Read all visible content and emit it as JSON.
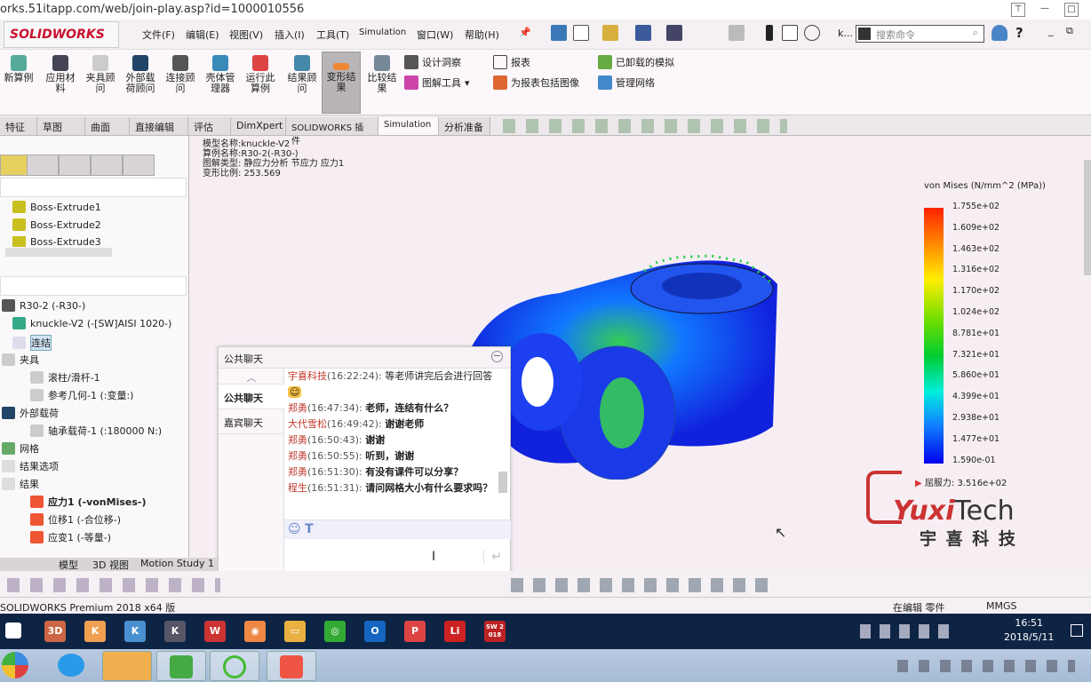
{
  "browser": {
    "url": "orks.51itapp.com/web/join-play.asp?id=1000010556"
  },
  "app": {
    "logo": "SOLIDWORKS",
    "menus": [
      "文件(F)",
      "编辑(E)",
      "视图(V)",
      "插入(I)",
      "工具(T)",
      "Simulation",
      "窗口(W)",
      "帮助(H)"
    ],
    "search_placeholder": "搜索命令",
    "k_label": "k..."
  },
  "ribbon": {
    "buttons": [
      "新算例",
      "应用材料",
      "夹具顾问",
      "外部载荷顾问",
      "连接顾问",
      "壳体管理器",
      "运行此算例",
      "结果顾问",
      "变形结果",
      "比较结果"
    ],
    "small": [
      "设计洞察",
      "图解工具",
      "报表",
      "为报表包括图像",
      "已卸载的模拟",
      "管理网络"
    ]
  },
  "tabs": [
    "特征",
    "草图",
    "曲面",
    "直接编辑",
    "评估",
    "DimXpert",
    "SOLIDWORKS 插件",
    "Simulation",
    "分析准备"
  ],
  "feature_tree": [
    "Boss-Extrude1",
    "Boss-Extrude2",
    "Boss-Extrude3"
  ],
  "study_tree": [
    "R30-2 (-R30-)",
    "knuckle-V2 (-[SW]AISI 1020-)",
    "连结",
    "夹具",
    "滚柱/滑杆-1",
    "参考几何-1 (:变量:)",
    "外部载荷",
    "轴承载荷-1 (:180000 N:)",
    "网格",
    "结果选项",
    "结果",
    "应力1 (-vonMises-)",
    "位移1 (-合位移-)",
    "应变1 (-等量-)"
  ],
  "plot_info": [
    "模型名称:knuckle-V2",
    "算例名称:R30-2(-R30-)",
    "图解类型: 静应力分析 节应力 应力1",
    "变形比例: 253.569"
  ],
  "legend": {
    "title": "von Mises (N/mm^2 (MPa))",
    "values": [
      "1.755e+02",
      "1.609e+02",
      "1.463e+02",
      "1.316e+02",
      "1.170e+02",
      "1.024e+02",
      "8.781e+01",
      "7.321e+01",
      "5.860e+01",
      "4.399e+01",
      "2.938e+01",
      "1.477e+01",
      "1.590e-01"
    ],
    "yield": "屈服力: 3.516e+02"
  },
  "watermark": {
    "brand": "YuxiTech",
    "cn": "宇 喜 科 技"
  },
  "chat": {
    "title": "公共聊天",
    "tabs": [
      "公共聊天",
      "嘉宾聊天"
    ],
    "messages": [
      {
        "name": "宇喜科技",
        "time": "(16:22:24):",
        "text": "等老师讲完后会进行回答",
        "bold": false
      },
      {
        "name": "郑勇",
        "time": "(16:47:34):",
        "text": "老师，连结有什么？",
        "bold": true
      },
      {
        "name": "大代雪松",
        "time": "(16:49:42):",
        "text": "谢谢老师",
        "bold": true
      },
      {
        "name": "郑勇",
        "time": "(16:50:43):",
        "text": "谢谢",
        "bold": true
      },
      {
        "name": "郑勇",
        "time": "(16:50:55):",
        "text": "听到，谢谢",
        "bold": true
      },
      {
        "name": "郑勇",
        "time": "(16:51:30):",
        "text": "有没有课件可以分享？",
        "bold": true
      },
      {
        "name": "程生",
        "time": "(16:51:31):",
        "text": "请问网格大小有什么要求吗？",
        "bold": true
      }
    ]
  },
  "bottom_tabs": [
    "模型",
    "3D 视图",
    "Motion Study 1"
  ],
  "status": {
    "product": "SOLIDWORKS Premium 2018 x64 版",
    "editing": "在编辑 零件",
    "units": "MMGS"
  },
  "taskbar": {
    "time": "16:51",
    "date": "2018/5/11",
    "apps": [
      "3D",
      "K",
      "K",
      "K",
      "WPS",
      "Chrome",
      "Explorer",
      "WeChat",
      "Outlook",
      "PowerPoint",
      "Live",
      "SW 2018"
    ]
  }
}
